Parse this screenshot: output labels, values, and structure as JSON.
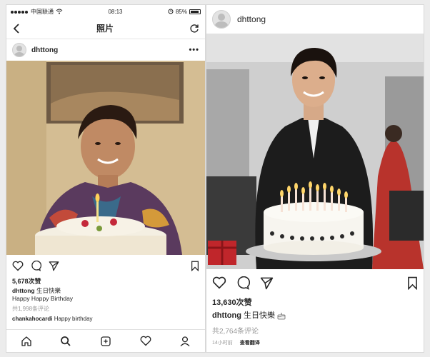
{
  "left": {
    "status": {
      "carrier": "中国联通",
      "time": "08:13",
      "battery": "85%"
    },
    "nav": {
      "title": "照片"
    },
    "post": {
      "username": "dhttong",
      "likes": "5,678次赞",
      "caption_user": "dhttong",
      "caption_text": "生日快樂",
      "caption_line2": "Happy Happy Birthday",
      "comments_link": "共1,998条评论",
      "reply_user": "chankahocardi",
      "reply_text": "Happy birthday"
    }
  },
  "right": {
    "post": {
      "username": "dhttong",
      "likes": "13,630次赞",
      "caption_user": "dhttong",
      "caption_text": "生日快樂",
      "comments_link": "共2,764条评论",
      "time_ago": "14小时前",
      "translate": "查看翻译"
    }
  },
  "icons": {
    "back": "chevron-left-icon",
    "refresh": "refresh-icon",
    "more": "more-icon",
    "like": "heart-icon",
    "comment": "comment-icon",
    "share": "send-icon",
    "save": "bookmark-icon",
    "home": "home-icon",
    "search": "search-icon",
    "add": "add-post-icon",
    "activity": "heart-icon",
    "profile": "profile-icon",
    "cake": "cake-icon",
    "wifi": "wifi-icon",
    "alarm": "alarm-icon"
  },
  "colors": {
    "text": "#262626",
    "muted": "#999999",
    "border": "#dbdbdb"
  }
}
